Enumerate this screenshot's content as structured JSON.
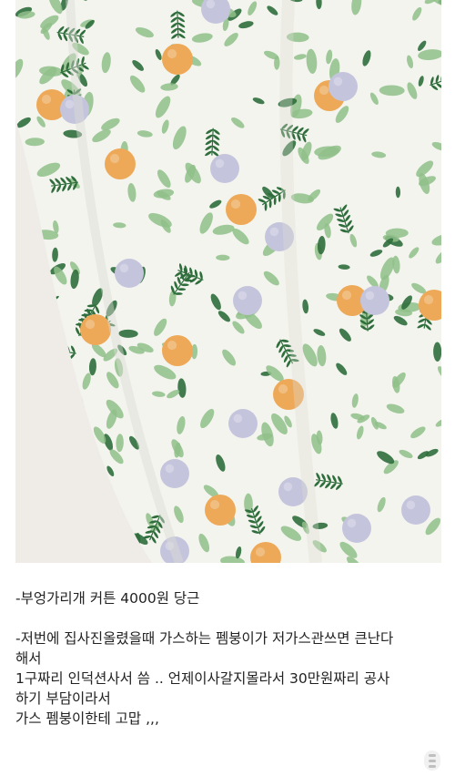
{
  "photo": {
    "subject": "curtain-fabric-photo",
    "colors": {
      "fabric_base": "#f4f4ef",
      "leaf_light": "#8fc089",
      "leaf_dark": "#2f6e3c",
      "orange_fruit": "#eda958",
      "lavender_fruit": "#c4c5dc",
      "wall": "#e8e4df"
    }
  },
  "post": {
    "line1": "-부엉가리개 커튼 4000원 당근",
    "line2": "-저번에 집사진올렸을때 가스하는 펨붕이가 저가스관쓰면 큰난다",
    "line3": "해서",
    "line4": "1구짜리 인덕션사서 씀 .. 언제이사갈지몰라서 30만원짜리 공사",
    "line5": "하기 부담이라서",
    "line6": "가스 펨붕이한테 고맙 ,,,"
  }
}
